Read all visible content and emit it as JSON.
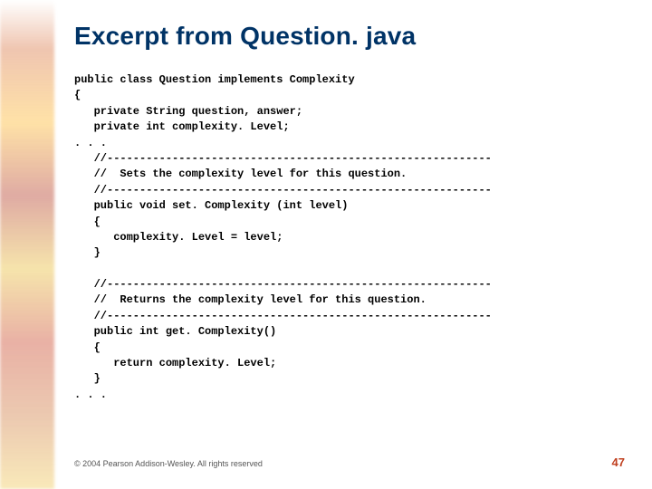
{
  "slide": {
    "title": "Excerpt from Question. java",
    "code_lines": [
      "public class Question implements Complexity",
      "{",
      "   private String question, answer;",
      "   private int complexity. Level;",
      ". . .",
      "   //-----------------------------------------------------------",
      "   //  Sets the complexity level for this question.",
      "   //-----------------------------------------------------------",
      "   public void set. Complexity (int level)",
      "   {",
      "      complexity. Level = level;",
      "   }",
      "",
      "   //-----------------------------------------------------------",
      "   //  Returns the complexity level for this question.",
      "   //-----------------------------------------------------------",
      "   public int get. Complexity()",
      "   {",
      "      return complexity. Level;",
      "   }",
      ". . ."
    ],
    "copyright": "© 2004 Pearson Addison-Wesley. All rights reserved",
    "page_number": "47"
  }
}
